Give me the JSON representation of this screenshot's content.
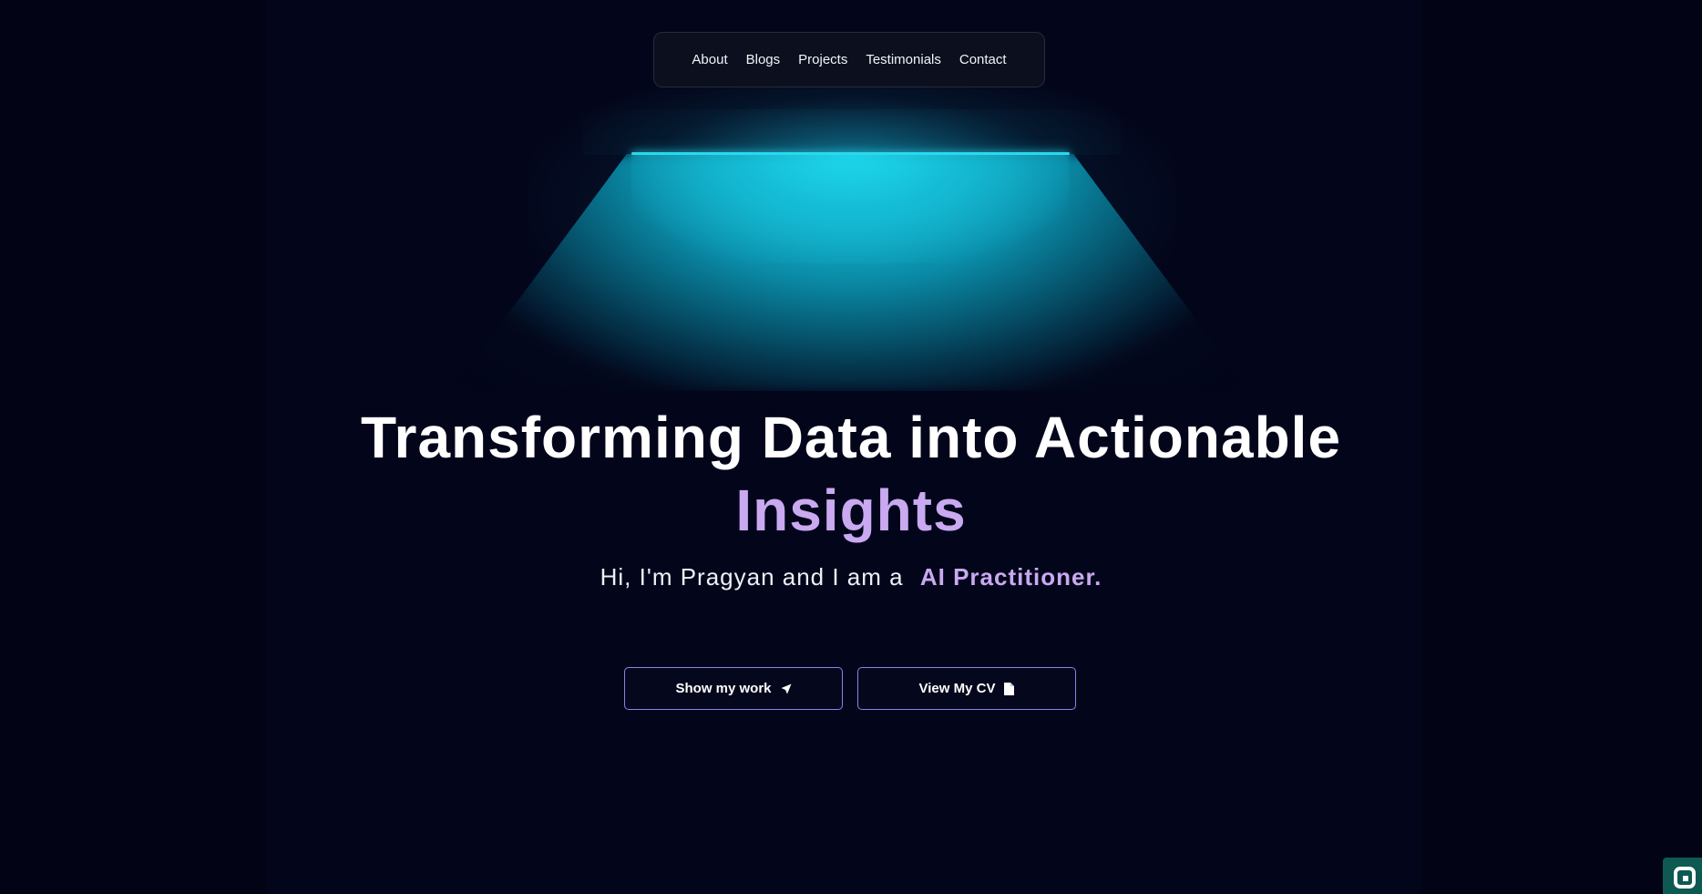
{
  "nav": {
    "items": [
      {
        "label": "About"
      },
      {
        "label": "Blogs"
      },
      {
        "label": "Projects"
      },
      {
        "label": "Testimonials"
      },
      {
        "label": "Contact"
      }
    ]
  },
  "hero": {
    "title_line1": "Transforming Data into Actionable",
    "title_highlight": "Insights",
    "subtitle_prefix": "Hi, I'm Pragyan and I am a",
    "subtitle_role": "AI Practitioner."
  },
  "buttons": {
    "work_label": "Show my work",
    "work_icon": "send-arrow-icon",
    "cv_label": "View My CV",
    "cv_icon": "document-icon"
  },
  "colors": {
    "background": "#03061b",
    "glow": "#1ad0e6",
    "accent": "#c9a9f0",
    "button_border": "#8a83e8"
  }
}
